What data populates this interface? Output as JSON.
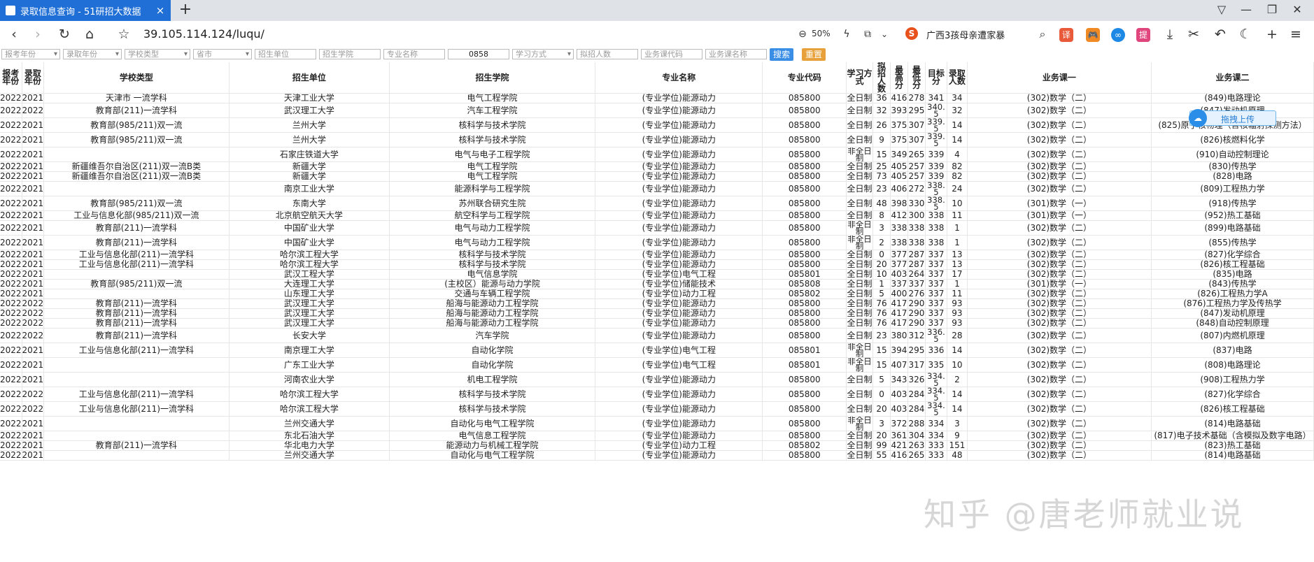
{
  "browser": {
    "tab_title": "录取信息查询 - 51研招大数据",
    "tab_close": "×",
    "new_tab": "+",
    "url": "39.105.114.124/luqu/",
    "zoom": "50%",
    "search_news": "广西3孩母亲遭家暴",
    "ext_labels": [
      "译",
      "🎮",
      "∞",
      "提"
    ]
  },
  "filters": {
    "report_year": "报考年份",
    "admit_year": "录取年份",
    "school_type": "学校类型",
    "province": "省市",
    "school": "招生单位",
    "college": "招生学院",
    "major_name": "专业名称",
    "major_code": "0858",
    "study_mode": "学习方式",
    "plan_num": "拟招人数",
    "course_code": "业务课代码",
    "course_name": "业务课名称",
    "search_btn": "搜索",
    "reset_btn": "重置"
  },
  "table": {
    "headers": [
      "报考年份",
      "录取年份",
      "学校类型",
      "招生单位",
      "招生学院",
      "专业名称",
      "专业代码",
      "学习方式",
      "拟招人数",
      "最高分",
      "最低分",
      "目标分",
      "录取人数",
      "业务课一",
      "业务课二"
    ],
    "rows": [
      [
        "2022",
        "2021",
        "天津市 一流学科",
        "天津工业大学",
        "电气工程学院",
        "(专业学位)能源动力",
        "085800",
        "全日制",
        "36",
        "416",
        "278",
        "341",
        "34",
        "(302)数学（二）",
        "(849)电路理论"
      ],
      [
        "2022",
        "2022",
        "教育部(211)一流学科",
        "武汉理工大学",
        "汽车工程学院",
        "(专业学位)能源动力",
        "085800",
        "全日制",
        "32",
        "393",
        "295",
        "340.5",
        "32",
        "(302)数学（二）",
        "(847)发动机原理"
      ],
      [
        "2022",
        "2021",
        "教育部(985/211)双一流",
        "兰州大学",
        "核科学与技术学院",
        "(专业学位)能源动力",
        "085800",
        "全日制",
        "26",
        "375",
        "307",
        "339.5",
        "14",
        "(302)数学（二）",
        "(825)原子核物理（含核辐射探测方法）"
      ],
      [
        "2022",
        "2021",
        "教育部(985/211)双一流",
        "兰州大学",
        "核科学与技术学院",
        "(专业学位)能源动力",
        "085800",
        "全日制",
        "9",
        "375",
        "307",
        "339.5",
        "14",
        "(302)数学（二）",
        "(826)核燃料化学"
      ],
      [
        "2022",
        "2021",
        "",
        "石家庄铁道大学",
        "电气与电子工程学院",
        "(专业学位)能源动力",
        "085800",
        "非全日制",
        "15",
        "349",
        "265",
        "339",
        "4",
        "(302)数学（二）",
        "(910)自动控制理论"
      ],
      [
        "2022",
        "2021",
        "新疆维吾尔自治区(211)双一流B类",
        "新疆大学",
        "电气工程学院",
        "(专业学位)能源动力",
        "085800",
        "全日制",
        "25",
        "405",
        "257",
        "339",
        "82",
        "(302)数学（二）",
        "(830)传热学"
      ],
      [
        "2022",
        "2021",
        "新疆维吾尔自治区(211)双一流B类",
        "新疆大学",
        "电气工程学院",
        "(专业学位)能源动力",
        "085800",
        "全日制",
        "73",
        "405",
        "257",
        "339",
        "82",
        "(302)数学（二）",
        "(828)电路"
      ],
      [
        "2022",
        "2021",
        "",
        "南京工业大学",
        "能源科学与工程学院",
        "(专业学位)能源动力",
        "085800",
        "全日制",
        "23",
        "406",
        "272",
        "338.5",
        "24",
        "(302)数学（二）",
        "(809)工程热力学"
      ],
      [
        "2022",
        "2021",
        "教育部(985/211)双一流",
        "东南大学",
        "苏州联合研究生院",
        "(专业学位)能源动力",
        "085800",
        "全日制",
        "48",
        "398",
        "330",
        "338.5",
        "10",
        "(301)数学（一）",
        "(918)传热学"
      ],
      [
        "2022",
        "2021",
        "工业与信息化部(985/211)双一流",
        "北京航空航天大学",
        "航空科学与工程学院",
        "(专业学位)能源动力",
        "085800",
        "全日制",
        "8",
        "412",
        "300",
        "338",
        "11",
        "(301)数学（一）",
        "(952)热工基础"
      ],
      [
        "2022",
        "2021",
        "教育部(211)一流学科",
        "中国矿业大学",
        "电气与动力工程学院",
        "(专业学位)能源动力",
        "085800",
        "非全日制",
        "3",
        "338",
        "338",
        "338",
        "1",
        "(302)数学（二）",
        "(899)电路基础"
      ],
      [
        "2022",
        "2021",
        "教育部(211)一流学科",
        "中国矿业大学",
        "电气与动力工程学院",
        "(专业学位)能源动力",
        "085800",
        "非全日制",
        "2",
        "338",
        "338",
        "338",
        "1",
        "(302)数学（二）",
        "(855)传热学"
      ],
      [
        "2022",
        "2021",
        "工业与信息化部(211)一流学科",
        "哈尔滨工程大学",
        "核科学与技术学院",
        "(专业学位)能源动力",
        "085800",
        "全日制",
        "0",
        "377",
        "287",
        "337",
        "13",
        "(302)数学（二）",
        "(827)化学综合"
      ],
      [
        "2022",
        "2021",
        "工业与信息化部(211)一流学科",
        "哈尔滨工程大学",
        "核科学与技术学院",
        "(专业学位)能源动力",
        "085800",
        "全日制",
        "20",
        "377",
        "287",
        "337",
        "13",
        "(302)数学（二）",
        "(826)核工程基础"
      ],
      [
        "2022",
        "2021",
        "",
        "武汉工程大学",
        "电气信息学院",
        "(专业学位)电气工程",
        "085801",
        "全日制",
        "10",
        "403",
        "264",
        "337",
        "17",
        "(302)数学（二）",
        "(835)电路"
      ],
      [
        "2022",
        "2021",
        "教育部(985/211)双一流",
        "大连理工大学",
        "(主校区）能源与动力学院",
        "(专业学位)储能技术",
        "085808",
        "全日制",
        "1",
        "337",
        "337",
        "337",
        "1",
        "(301)数学（一）",
        "(843)传热学"
      ],
      [
        "2022",
        "2021",
        "",
        "山东理工大学",
        "交通与车辆工程学院",
        "(专业学位)动力工程",
        "085802",
        "全日制",
        "5",
        "400",
        "276",
        "337",
        "11",
        "(302)数学（二）",
        "(826)工程热力学A"
      ],
      [
        "2022",
        "2022",
        "教育部(211)一流学科",
        "武汉理工大学",
        "船海与能源动力工程学院",
        "(专业学位)能源动力",
        "085800",
        "全日制",
        "76",
        "417",
        "290",
        "337",
        "93",
        "(302)数学（二）",
        "(876)工程热力学及传热学"
      ],
      [
        "2022",
        "2022",
        "教育部(211)一流学科",
        "武汉理工大学",
        "船海与能源动力工程学院",
        "(专业学位)能源动力",
        "085800",
        "全日制",
        "76",
        "417",
        "290",
        "337",
        "93",
        "(302)数学（二）",
        "(847)发动机原理"
      ],
      [
        "2022",
        "2022",
        "教育部(211)一流学科",
        "武汉理工大学",
        "船海与能源动力工程学院",
        "(专业学位)能源动力",
        "085800",
        "全日制",
        "76",
        "417",
        "290",
        "337",
        "93",
        "(302)数学（二）",
        "(848)自动控制原理"
      ],
      [
        "2022",
        "2022",
        "教育部(211)一流学科",
        "长安大学",
        "汽车学院",
        "(专业学位)能源动力",
        "085800",
        "全日制",
        "23",
        "380",
        "312",
        "336.5",
        "28",
        "(302)数学（二）",
        "(807)内燃机原理"
      ],
      [
        "2022",
        "2021",
        "工业与信息化部(211)一流学科",
        "南京理工大学",
        "自动化学院",
        "(专业学位)电气工程",
        "085801",
        "非全日制",
        "15",
        "394",
        "295",
        "336",
        "14",
        "(302)数学（二）",
        "(837)电路"
      ],
      [
        "2022",
        "2021",
        "",
        "广东工业大学",
        "自动化学院",
        "(专业学位)电气工程",
        "085801",
        "非全日制",
        "15",
        "407",
        "317",
        "335",
        "10",
        "(302)数学（二）",
        "(808)电路理论"
      ],
      [
        "2022",
        "2021",
        "",
        "河南农业大学",
        "机电工程学院",
        "(专业学位)能源动力",
        "085800",
        "全日制",
        "5",
        "343",
        "326",
        "334.5",
        "2",
        "(302)数学（二）",
        "(908)工程热力学"
      ],
      [
        "2022",
        "2022",
        "工业与信息化部(211)一流学科",
        "哈尔滨工程大学",
        "核科学与技术学院",
        "(专业学位)能源动力",
        "085800",
        "全日制",
        "0",
        "403",
        "284",
        "334.5",
        "14",
        "(302)数学（二）",
        "(827)化学综合"
      ],
      [
        "2022",
        "2022",
        "工业与信息化部(211)一流学科",
        "哈尔滨工程大学",
        "核科学与技术学院",
        "(专业学位)能源动力",
        "085800",
        "全日制",
        "20",
        "403",
        "284",
        "334.5",
        "14",
        "(302)数学（二）",
        "(826)核工程基础"
      ],
      [
        "2022",
        "2021",
        "",
        "兰州交通大学",
        "自动化与电气工程学院",
        "(专业学位)能源动力",
        "085800",
        "非全日制",
        "3",
        "372",
        "288",
        "334",
        "3",
        "(302)数学（二）",
        "(814)电路基础"
      ],
      [
        "2022",
        "2021",
        "",
        "东北石油大学",
        "电气信息工程学院",
        "(专业学位)能源动力",
        "085800",
        "全日制",
        "20",
        "361",
        "304",
        "334",
        "9",
        "(302)数学（二）",
        "(817)电子技术基础（含模拟及数字电路）"
      ],
      [
        "2022",
        "2021",
        "教育部(211)一流学科",
        "华北电力大学",
        "能源动力与机械工程学院",
        "(专业学位)动力工程",
        "085802",
        "全日制",
        "99",
        "421",
        "263",
        "333",
        "151",
        "(302)数学（二）",
        "(823)热工基础"
      ],
      [
        "2022",
        "2021",
        "",
        "兰州交通大学",
        "自动化与电气工程学院",
        "(专业学位)能源动力",
        "085800",
        "全日制",
        "55",
        "416",
        "265",
        "333",
        "48",
        "(302)数学（二）",
        "(814)电路基础"
      ]
    ]
  },
  "upload_widget": {
    "label": "拖拽上传"
  },
  "watermark": "知乎 @唐老师就业说"
}
